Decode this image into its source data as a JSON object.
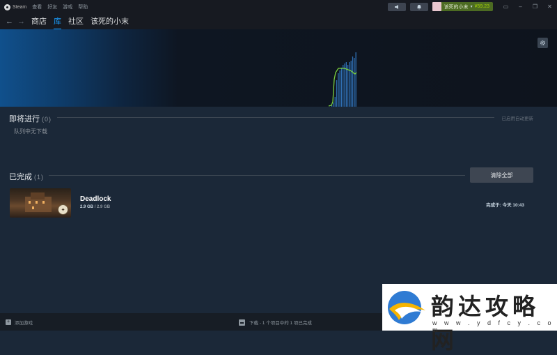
{
  "titlebar": {
    "app_name": "Steam",
    "menu": [
      "查看",
      "好友",
      "游戏",
      "帮助"
    ],
    "account_name": "该死的小末",
    "balance": "¥59.23"
  },
  "nav": {
    "links": [
      "商店",
      "库",
      "社区",
      "该死的小末"
    ],
    "active_index": 1
  },
  "queue": {
    "title": "即将进行",
    "count": "(0)",
    "auto_update": "已启用自动更新",
    "empty_message": "队列中无下载"
  },
  "completed": {
    "title": "已完成",
    "count": "(1)",
    "clear_all": "清除全部",
    "items": [
      {
        "name": "Deadlock",
        "size_done": "2.9 GB",
        "size_sep": "/",
        "size_total": "2.9 GB",
        "completed_label": "完成于:",
        "completed_time": "今天 10:43"
      }
    ]
  },
  "bottombar": {
    "add_game": "添加游戏",
    "download_status": "下载 - 1 个项目中的 1 项已完成"
  },
  "watermark": {
    "text": "韵达攻略网",
    "url": "w w w . y d f c y . c o m"
  },
  "colors": {
    "accent": "#1a9fff",
    "graph_line": "#7bd13e",
    "graph_bars": "#2f6fb3",
    "background": "#1b2838"
  },
  "icons": {
    "logo": "steam-logo-icon",
    "broadcast": "megaphone-icon",
    "notifications": "bell-icon",
    "settings": "gear-icon",
    "add": "plus-icon",
    "download": "download-icon"
  }
}
